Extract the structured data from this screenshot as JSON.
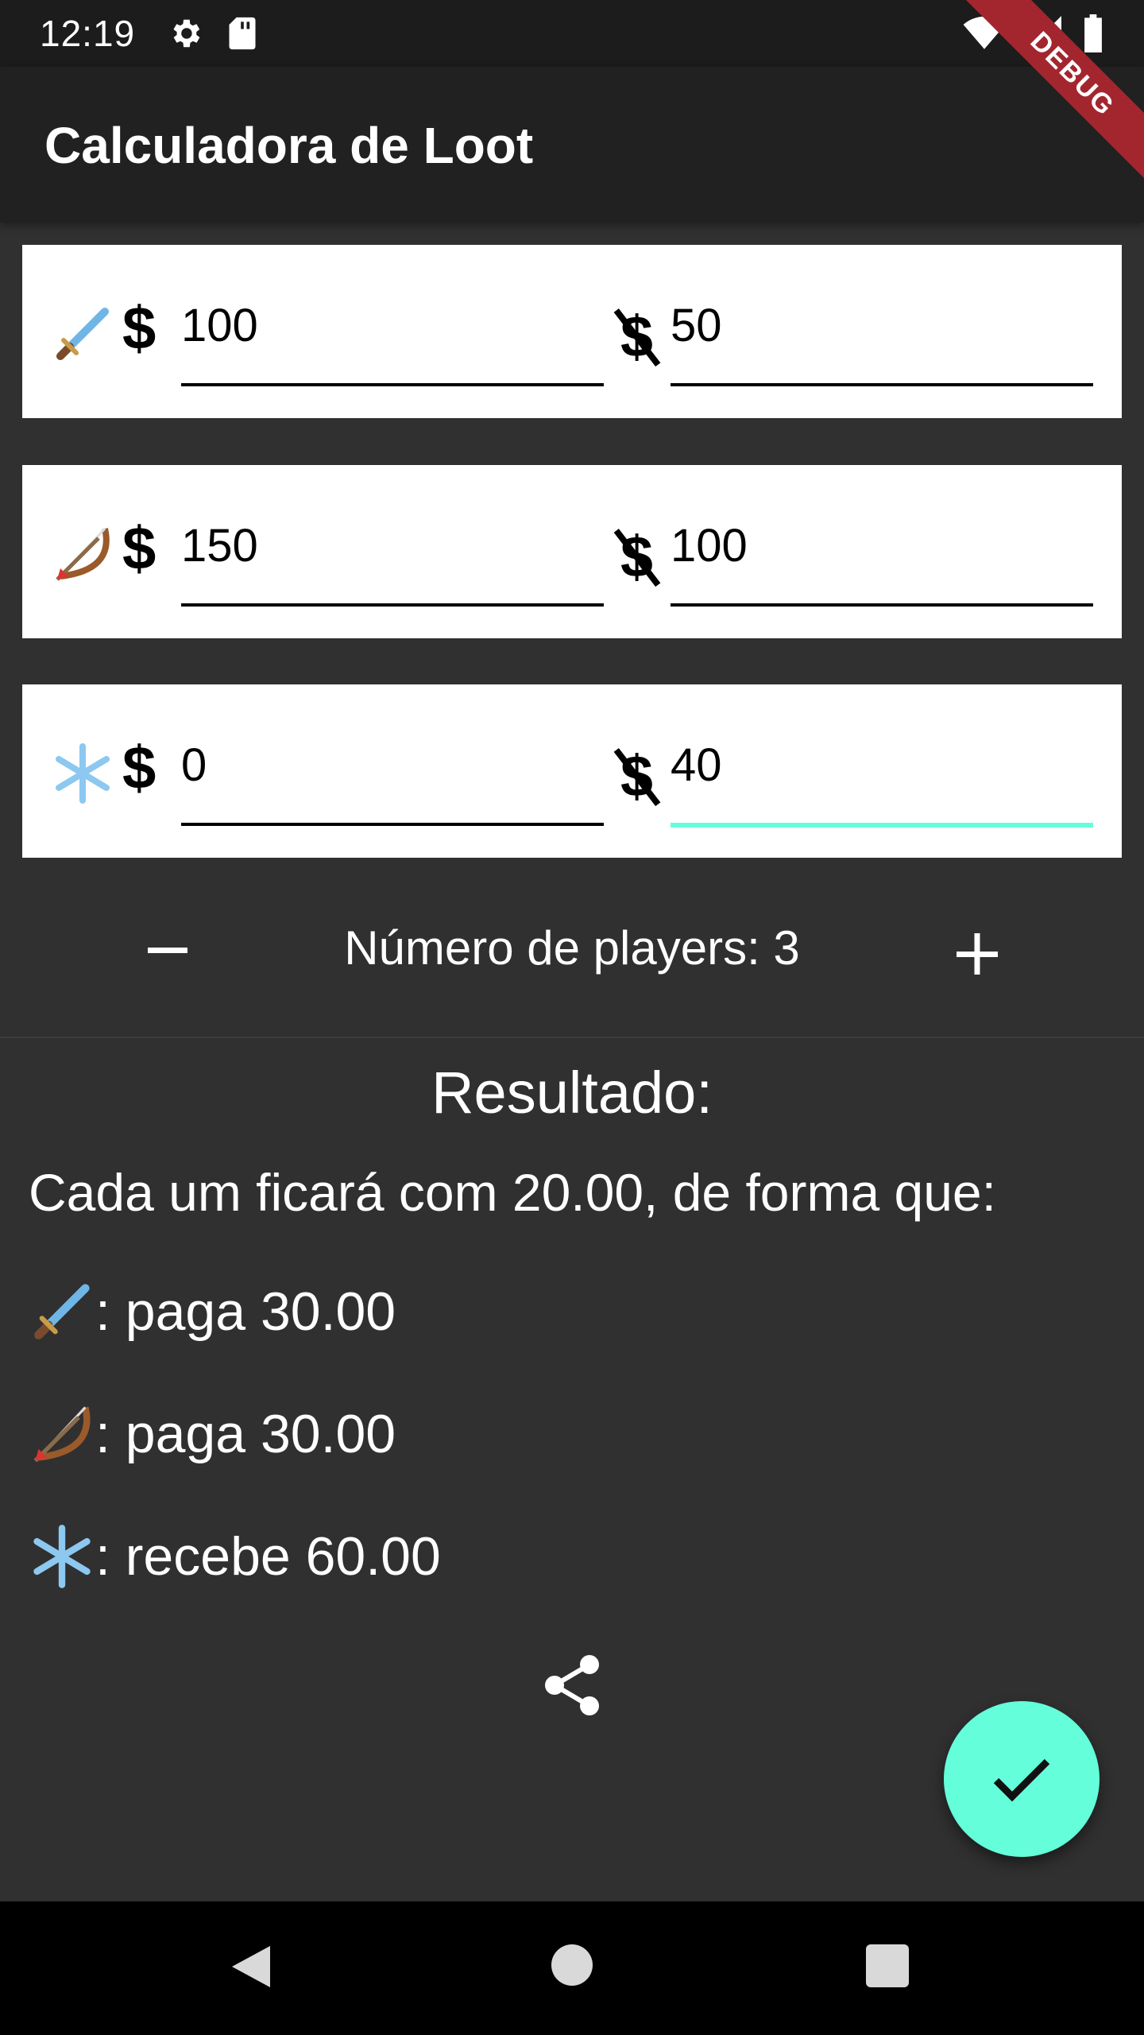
{
  "status_bar": {
    "time": "12:19",
    "icons": [
      "gear-icon",
      "sd-card-icon",
      "wifi-icon",
      "signal-icon",
      "battery-icon"
    ],
    "debug_banner": "DEBUG"
  },
  "app_bar": {
    "title": "Calculadora de Loot"
  },
  "players": [
    {
      "icon": "sword-emoji",
      "loot_value": "100",
      "waste_value": "50"
    },
    {
      "icon": "bow-arrow-emoji",
      "loot_value": "150",
      "waste_value": "100"
    },
    {
      "icon": "snowflake-emoji",
      "loot_value": "0",
      "waste_value": "40"
    }
  ],
  "icons": {
    "loot": "dollar-icon",
    "waste": "money-off-icon"
  },
  "counter": {
    "label": "Número de players: 3"
  },
  "result": {
    "title": "Resultado:",
    "summary": "Cada um ficará com 20.00, de forma que:",
    "lines": [
      {
        "icon": "sword-emoji",
        "text": ": paga 30.00"
      },
      {
        "icon": "bow-arrow-emoji",
        "text": ": paga 30.00"
      },
      {
        "icon": "snowflake-emoji",
        "text": ": recebe 60.00"
      }
    ]
  },
  "colors": {
    "accent": "#64ffda",
    "background": "#303030",
    "app_bar": "#212121",
    "debug": "#a3262f"
  }
}
